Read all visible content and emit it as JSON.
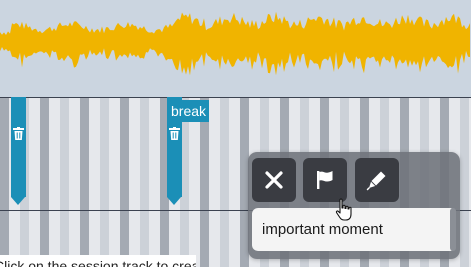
{
  "waveform": {
    "color": "#f0b400",
    "background": "#cbd5e0"
  },
  "timeline": {
    "background": "#e6e8ec",
    "stripe_dark": "#a4aab3",
    "stripe_mid": "#ccd1d8",
    "mark_color": "#1b8fb7"
  },
  "marks": [
    {
      "label": "",
      "delete_icon": "trash-icon"
    },
    {
      "label": "break",
      "delete_icon": "trash-icon"
    }
  ],
  "popup": {
    "buttons": [
      {
        "name": "close",
        "icon": "close-icon"
      },
      {
        "name": "flag",
        "icon": "flag-icon"
      },
      {
        "name": "edit",
        "icon": "pen-icon"
      }
    ],
    "input_value": "important moment"
  },
  "hint": {
    "text": "Click on the session track to create a mark"
  }
}
